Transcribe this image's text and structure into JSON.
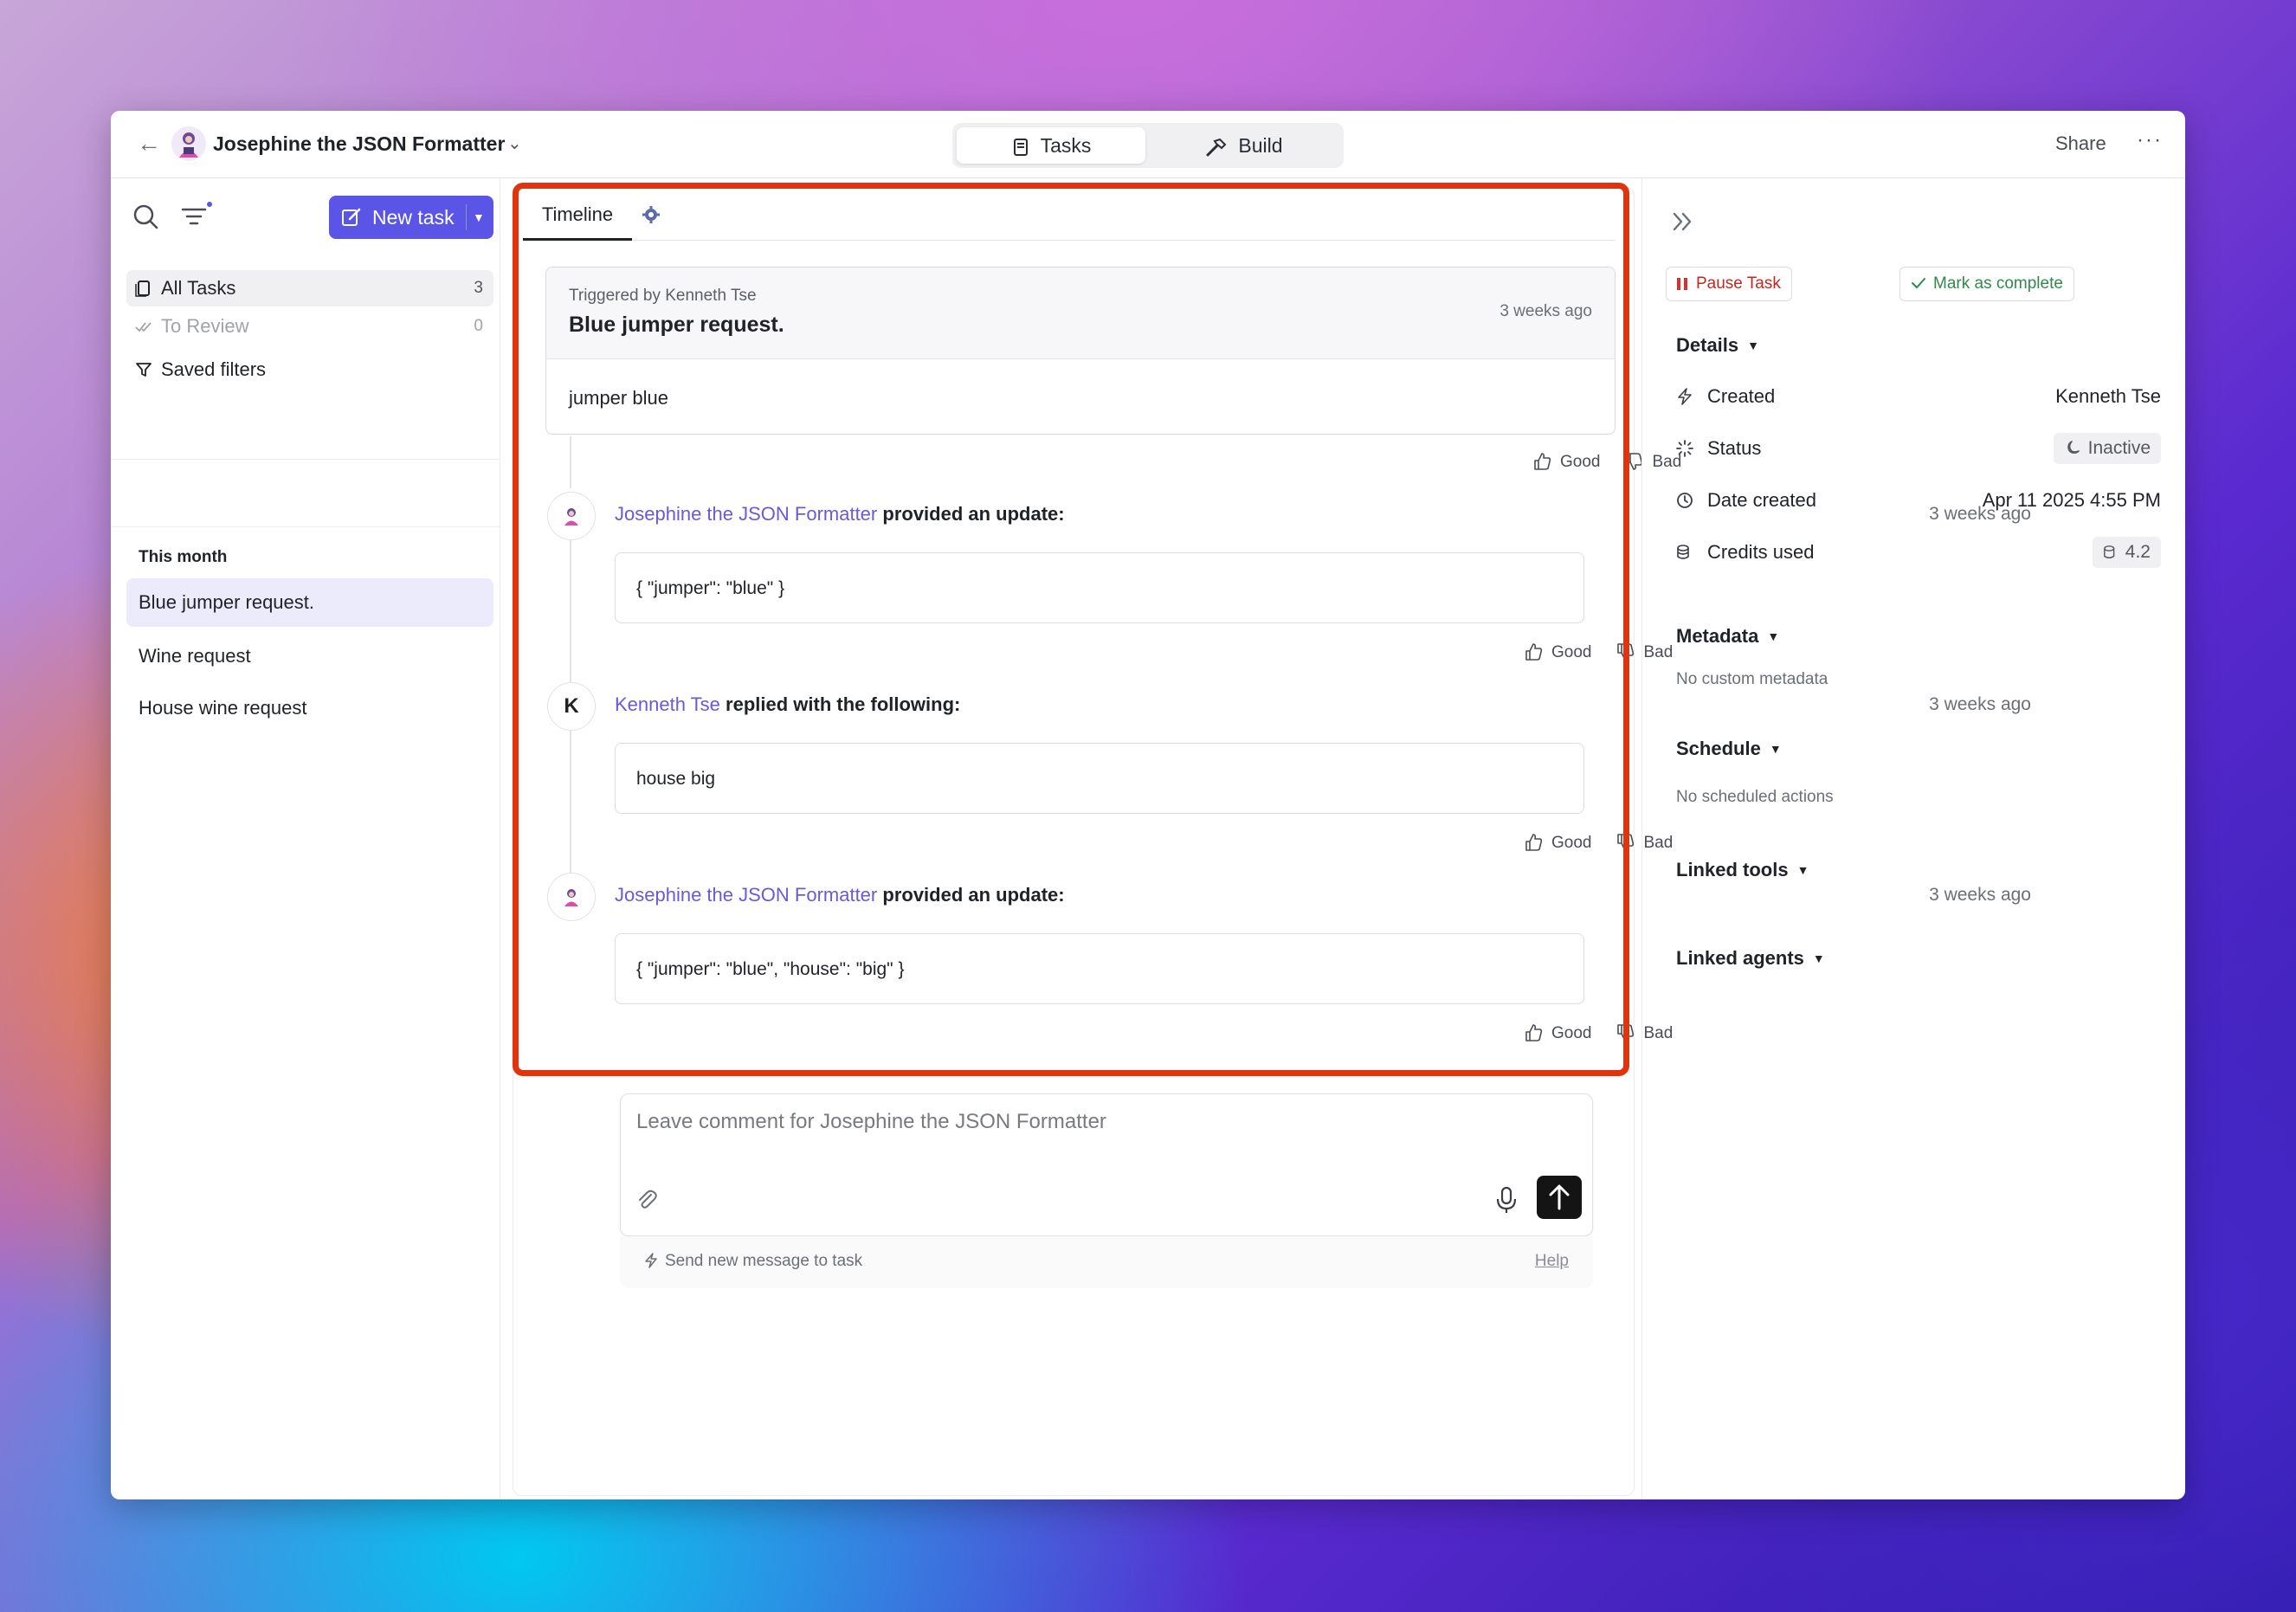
{
  "header": {
    "agent_name": "Josephine the JSON Formatter",
    "tabs": [
      "Tasks",
      "Build"
    ],
    "share": "Share",
    "more": "···"
  },
  "sidebar": {
    "new_task": "New task",
    "nav": [
      {
        "label": "All Tasks",
        "count": "3"
      },
      {
        "label": "To Review",
        "count": "0"
      },
      {
        "label": "Saved filters"
      }
    ],
    "section": "This month",
    "tasks": [
      "Blue jumper request.",
      "Wine request",
      "House wine request"
    ]
  },
  "timeline": {
    "tab_label": "Timeline",
    "trigger": {
      "by": "Triggered by Kenneth Tse",
      "title": "Blue jumper request.",
      "time": "3 weeks ago",
      "body": "jumper blue"
    },
    "feedback": {
      "good": "Good",
      "bad": "Bad"
    },
    "events": [
      {
        "avatar": "",
        "who": "Josephine the JSON Formatter",
        "action": "provided an update:",
        "time": "3 weeks ago",
        "content": "{ \"jumper\": \"blue\" }"
      },
      {
        "avatar": "K",
        "who": "Kenneth Tse",
        "action": "replied with the following:",
        "time": "3 weeks ago",
        "content": "house big"
      },
      {
        "avatar": "",
        "who": "Josephine the JSON Formatter",
        "action": "provided an update:",
        "time": "3 weeks ago",
        "content": "{ \"jumper\": \"blue\", \"house\": \"big\" }"
      }
    ]
  },
  "comment": {
    "placeholder": "Leave comment for Josephine the JSON Formatter",
    "footer_text": "Send new message to task",
    "help": "Help"
  },
  "details": {
    "pause": "Pause Task",
    "complete": "Mark as complete",
    "title": "Details",
    "created_label": "Created",
    "created_value": "Kenneth Tse",
    "status_label": "Status",
    "status_value": "Inactive",
    "date_label": "Date created",
    "date_value": "Apr 11 2025 4:55 PM",
    "credits_label": "Credits used",
    "credits_value": "4.2",
    "metadata_title": "Metadata",
    "metadata_empty": "No custom metadata",
    "schedule_title": "Schedule",
    "schedule_empty": "No scheduled actions",
    "tools_title": "Linked tools",
    "agents_title": "Linked agents"
  },
  "colors": {
    "accent": "#5a55e6",
    "link": "#6a5ad8",
    "highlight": "#e1330e"
  }
}
